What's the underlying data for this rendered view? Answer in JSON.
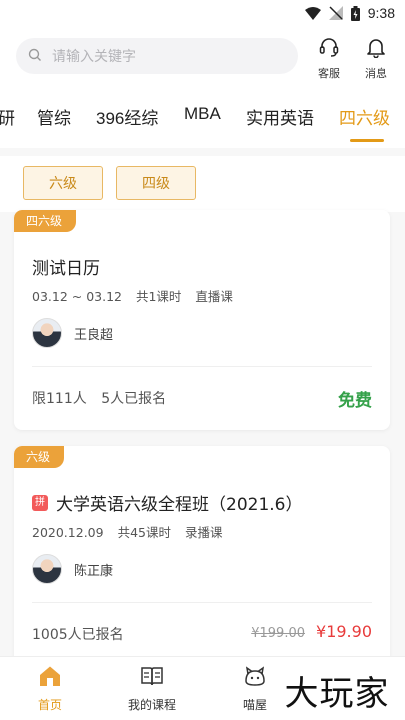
{
  "status_bar": {
    "time": "9:38"
  },
  "search": {
    "placeholder": "请输入关键字"
  },
  "header_actions": {
    "service": "客服",
    "messages": "消息"
  },
  "categories": {
    "tabs": [
      "研",
      "管综",
      "396经综",
      "MBA",
      "实用英语",
      "四六级"
    ],
    "active_index": 5
  },
  "level_filter": [
    "六级",
    "四级"
  ],
  "courses": [
    {
      "tag": "四六级",
      "title": "测试日历",
      "has_group_badge": false,
      "date": "03.12 ~ 03.12",
      "lessons": "共1课时",
      "type": "直播课",
      "teacher": "王良超",
      "limit": "限111人",
      "enrolled": "5人已报名",
      "price": "免费"
    },
    {
      "tag": "六级",
      "title": "大学英语六级全程班（2021.6）",
      "has_group_badge": true,
      "group_badge": "拼",
      "date": "2020.12.09",
      "lessons": "共45课时",
      "type": "录播课",
      "teacher": "陈正康",
      "enrolled": "1005人已报名",
      "original_price": "¥199.00",
      "price": "¥19.90"
    }
  ],
  "bottom_nav": {
    "home": "首页",
    "my_courses": "我的课程",
    "house": "喵屋"
  },
  "watermark": "大玩家",
  "colors": {
    "accent": "#e39a17",
    "free": "#35a14a",
    "sale": "#e83b3b",
    "tag": "#eba23a"
  }
}
